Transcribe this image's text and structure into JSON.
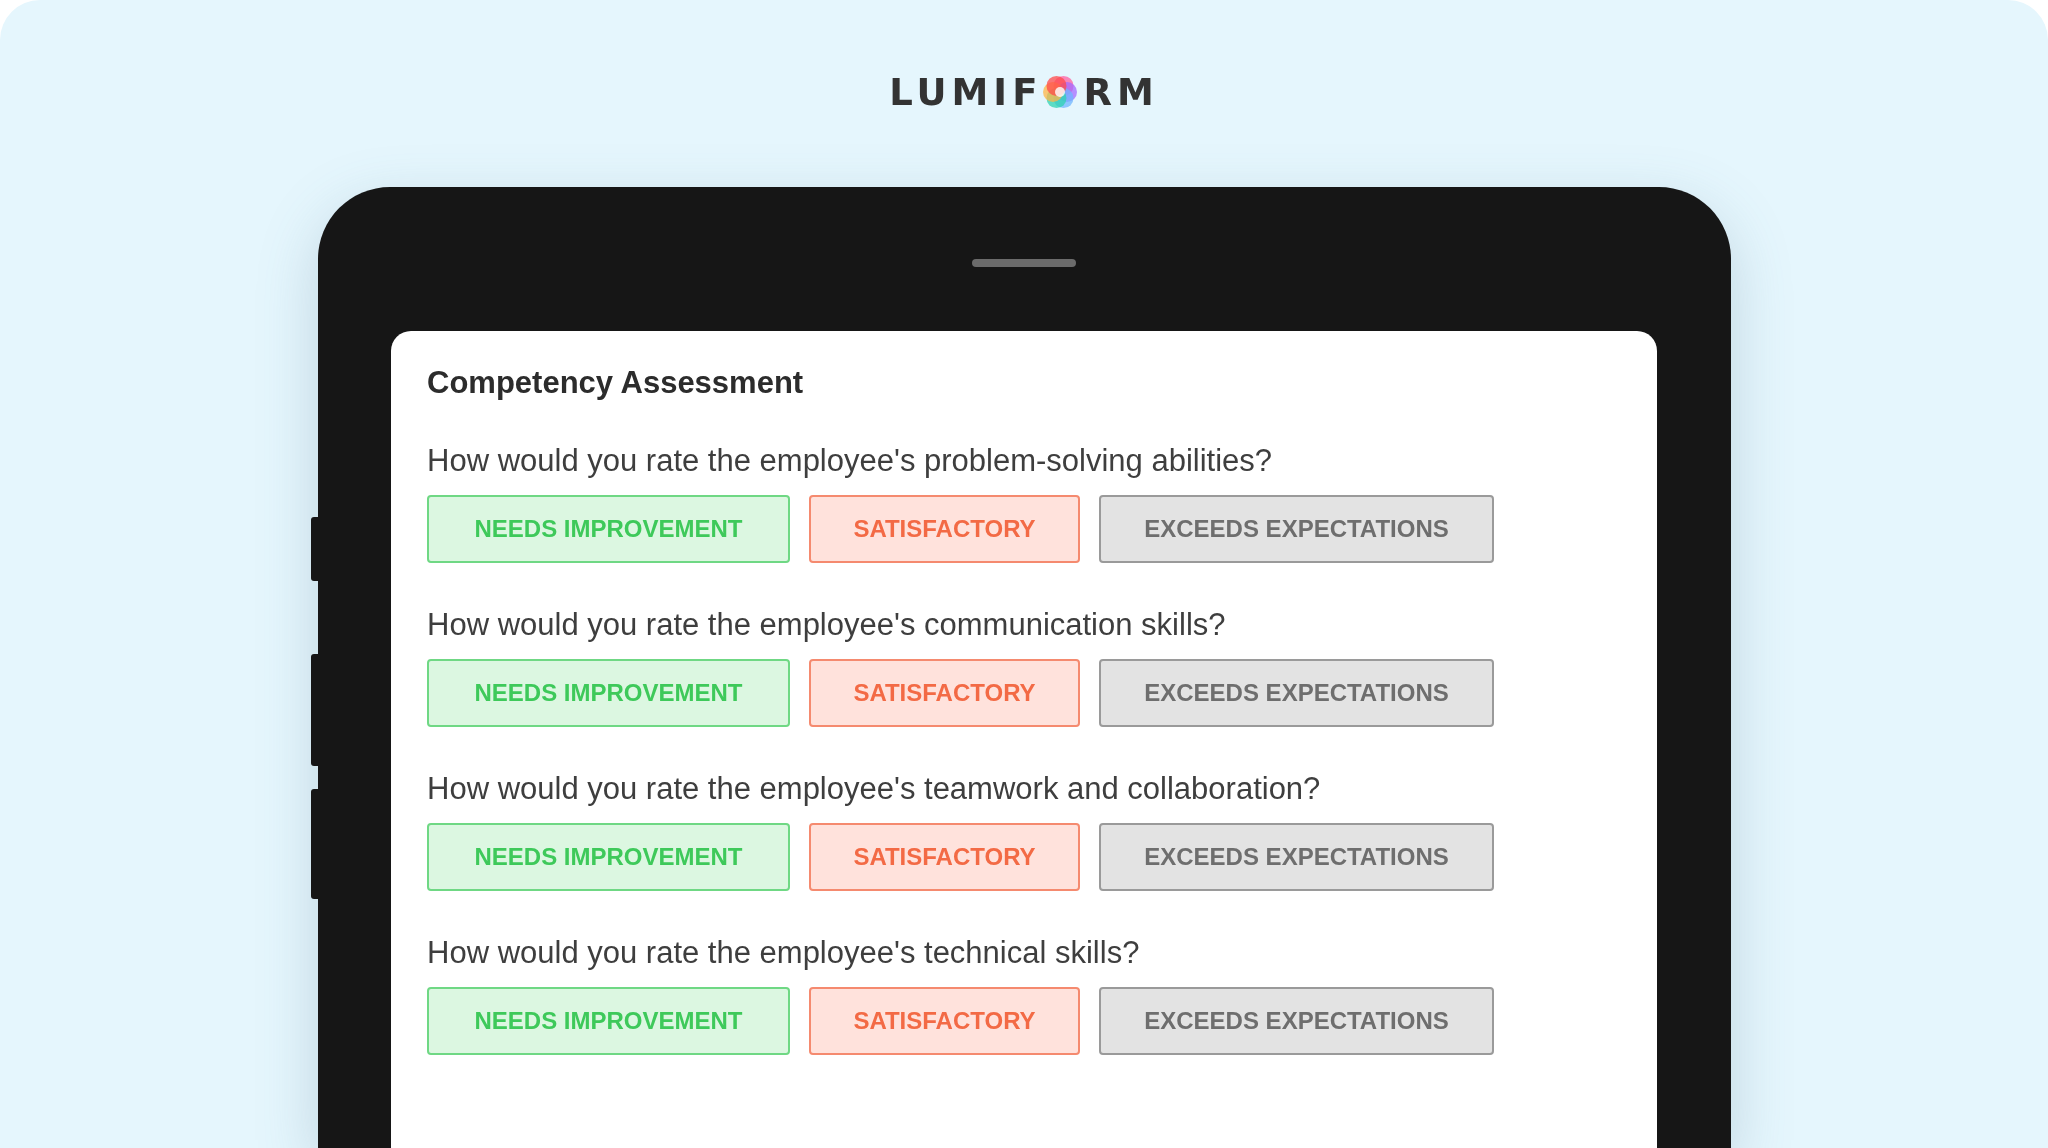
{
  "logo": {
    "before": "LUMIF",
    "after": "RM"
  },
  "form": {
    "title": "Competency Assessment",
    "questions": [
      {
        "text": "How would you rate the employee's problem-solving abilities?",
        "options": [
          {
            "label": "NEEDS IMPROVEMENT",
            "kind": "low"
          },
          {
            "label": "SATISFACTORY",
            "kind": "mid"
          },
          {
            "label": "EXCEEDS EXPECTATIONS",
            "kind": "high"
          }
        ]
      },
      {
        "text": "How would you rate the employee's communication skills?",
        "options": [
          {
            "label": "NEEDS IMPROVEMENT",
            "kind": "low"
          },
          {
            "label": "SATISFACTORY",
            "kind": "mid"
          },
          {
            "label": "EXCEEDS EXPECTATIONS",
            "kind": "high"
          }
        ]
      },
      {
        "text": "How would you rate the employee's teamwork and collaboration?",
        "options": [
          {
            "label": "NEEDS IMPROVEMENT",
            "kind": "low"
          },
          {
            "label": "SATISFACTORY",
            "kind": "mid"
          },
          {
            "label": "EXCEEDS EXPECTATIONS",
            "kind": "high"
          }
        ]
      },
      {
        "text": "How would you rate the employee's technical skills?",
        "options": [
          {
            "label": "NEEDS IMPROVEMENT",
            "kind": "low"
          },
          {
            "label": "SATISFACTORY",
            "kind": "mid"
          },
          {
            "label": "EXCEEDS EXPECTATIONS",
            "kind": "high"
          }
        ]
      }
    ]
  }
}
